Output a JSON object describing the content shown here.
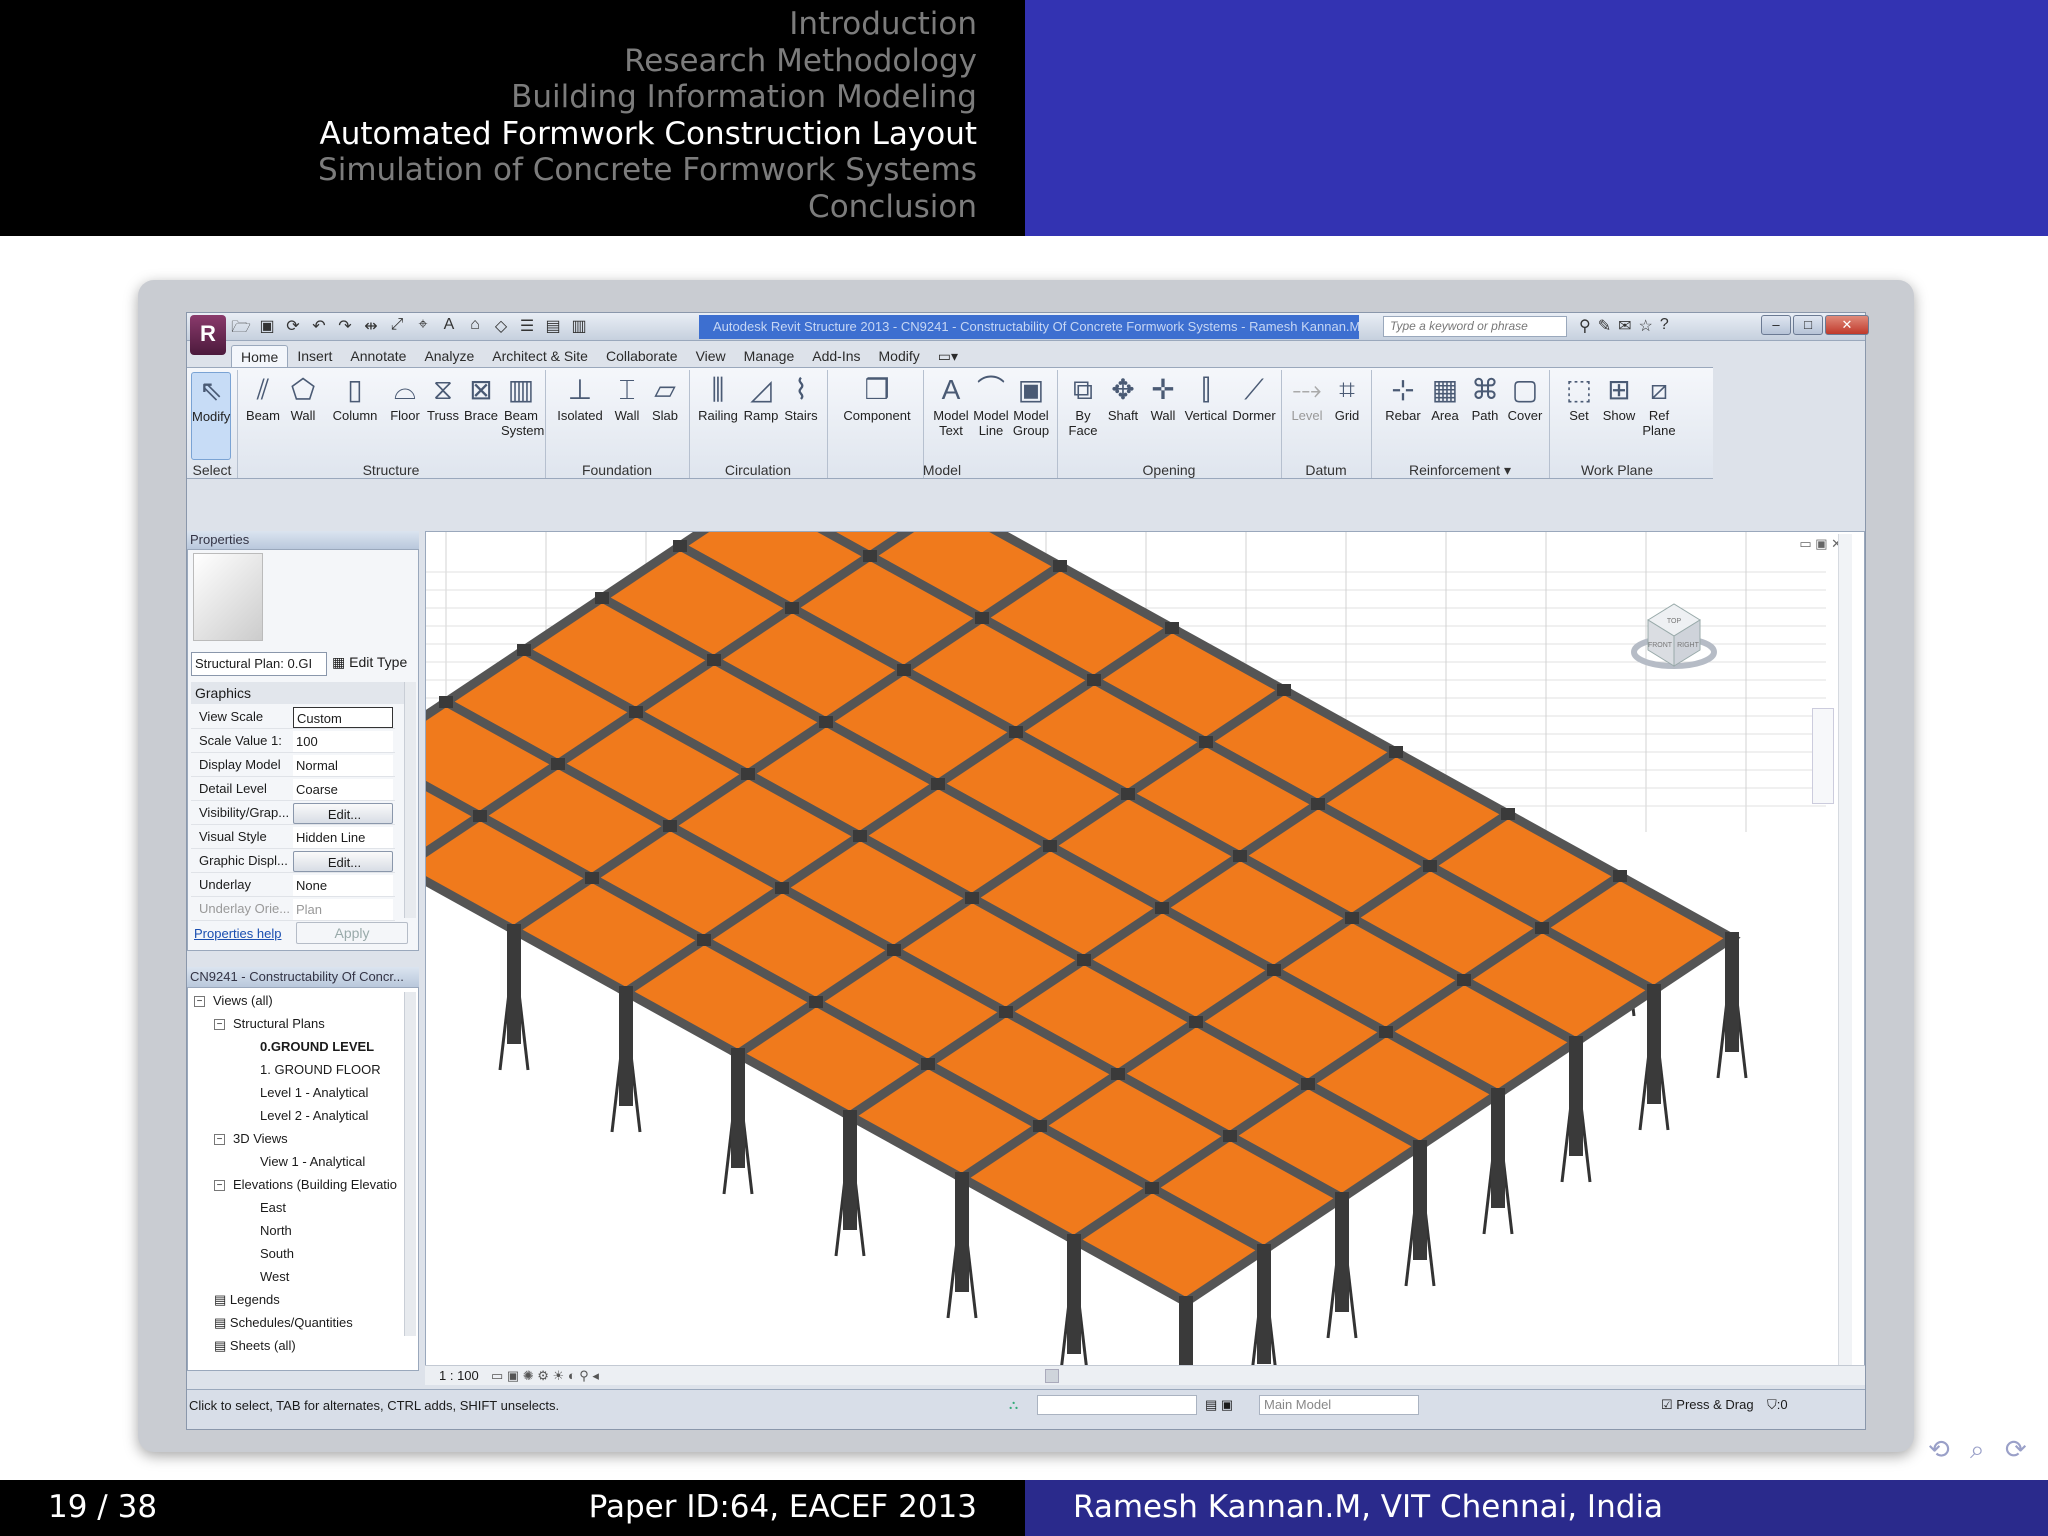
{
  "slide": {
    "nav_sections": [
      "Introduction",
      "Research Methodology",
      "Building Information Modeling",
      "Automated Formwork Construction Layout",
      "Simulation of Concrete Formwork Systems",
      "Conclusion"
    ],
    "active_index": 3,
    "footer": {
      "page": "19 / 38",
      "paper_id": "Paper ID:64, EACEF 2013",
      "author": "Ramesh Kannan.M, VIT Chennai, India"
    },
    "nav_symbols": "⟲ ⌕ ⟳"
  },
  "revit": {
    "title": "Autodesk Revit Structure 2013 - CN9241 - Constructability Of Concrete Formwork Systems - Ramesh Kannan.M",
    "search_placeholder": "Type a keyword or phrase",
    "tabs": [
      "Home",
      "Insert",
      "Annotate",
      "Analyze",
      "Architect & Site",
      "Collaborate",
      "View",
      "Manage",
      "Add-Ins",
      "Modify"
    ],
    "tools": {
      "modify": "Modify",
      "beam": "Beam",
      "wall": "Wall",
      "column": "Column",
      "floor": "Floor",
      "truss": "Truss",
      "brace": "Brace",
      "beam_system": "Beam System",
      "isolated": "Isolated",
      "wall_f": "Wall",
      "slab": "Slab",
      "railing": "Railing",
      "ramp": "Ramp",
      "stairs": "Stairs",
      "component": "Component",
      "model_text": "Model Text",
      "model_line": "Model Line",
      "model_group": "Model Group",
      "by_face": "By Face",
      "shaft": "Shaft",
      "wall_o": "Wall",
      "vertical": "Vertical",
      "dormer": "Dormer",
      "level": "Level",
      "grid": "Grid",
      "rebar": "Rebar",
      "area": "Area",
      "path": "Path",
      "cover": "Cover",
      "set": "Set",
      "show": "Show",
      "ref_plane": "Ref Plane"
    },
    "panels": {
      "select": "Select",
      "structure": "Structure",
      "foundation": "Foundation",
      "circulation": "Circulation",
      "model": "Model",
      "opening": "Opening",
      "datum": "Datum",
      "reinforcement": "Reinforcement ▾",
      "work_plane": "Work Plane"
    },
    "properties": {
      "header": "Properties",
      "type_selector": "Structural Plan: 0.GI",
      "edit_type": "Edit Type",
      "group": "Graphics",
      "rows": [
        {
          "k": "View Scale",
          "v": "Custom"
        },
        {
          "k": "Scale Value    1:",
          "v": "100"
        },
        {
          "k": "Display Model",
          "v": "Normal"
        },
        {
          "k": "Detail Level",
          "v": "Coarse"
        },
        {
          "k": "Visibility/Grap...",
          "v": "Edit..."
        },
        {
          "k": "Visual Style",
          "v": "Hidden Line"
        },
        {
          "k": "Graphic Displ...",
          "v": "Edit..."
        },
        {
          "k": "Underlay",
          "v": "None"
        },
        {
          "k": "Underlay Orie...",
          "v": "Plan"
        }
      ],
      "help": "Properties help",
      "apply": "Apply"
    },
    "browser": {
      "header": "CN9241 - Constructability Of Concr...",
      "nodes": [
        "Views (all)",
        "Structural Plans",
        "0.GROUND LEVEL",
        "1. GROUND FLOOR",
        "Level 1 - Analytical",
        "Level 2 - Analytical",
        "3D Views",
        "View 1 - Analytical",
        "Elevations (Building Elevatio",
        "East",
        "North",
        "South",
        "West",
        "Legends",
        "Schedules/Quantities",
        "Sheets (all)"
      ]
    },
    "viewbar": {
      "scale": "1 : 100"
    },
    "status": {
      "hint": "Click to select, TAB for alternates, CTRL adds, SHIFT unselects.",
      "model": "Main Model",
      "press_drag": "Press & Drag",
      "filter": ":0"
    },
    "viewcube": {
      "top": "TOP",
      "front": "FRONT",
      "right": "RIGHT"
    },
    "colors": {
      "formwork": "#f07a1c",
      "frame": "#555555"
    }
  }
}
